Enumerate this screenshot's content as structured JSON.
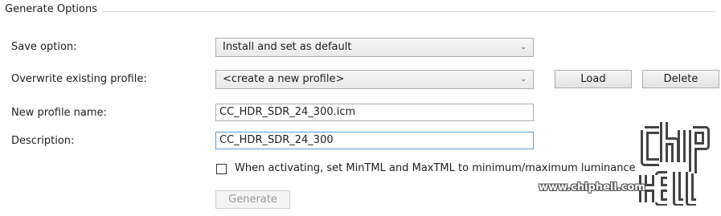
{
  "group": {
    "title": "Generate Options"
  },
  "save_option": {
    "label": "Save option:",
    "value": "Install and set as default"
  },
  "overwrite": {
    "label": "Overwrite existing profile:",
    "value": "<create a new profile>",
    "load_label": "Load",
    "delete_label": "Delete"
  },
  "profile_name": {
    "label": "New profile name:",
    "value": "CC_HDR_SDR_24_300.icm"
  },
  "description": {
    "label": "Description:",
    "value": "CC_HDR_SDR_24_300"
  },
  "tml_checkbox": {
    "label": "When activating, set MinTML and MaxTML to minimum/maximum luminance",
    "checked": false
  },
  "generate": {
    "label": "Generate",
    "enabled": false
  },
  "watermark": {
    "url": "www.chiphell.com",
    "logo": "chiphell-logo"
  }
}
